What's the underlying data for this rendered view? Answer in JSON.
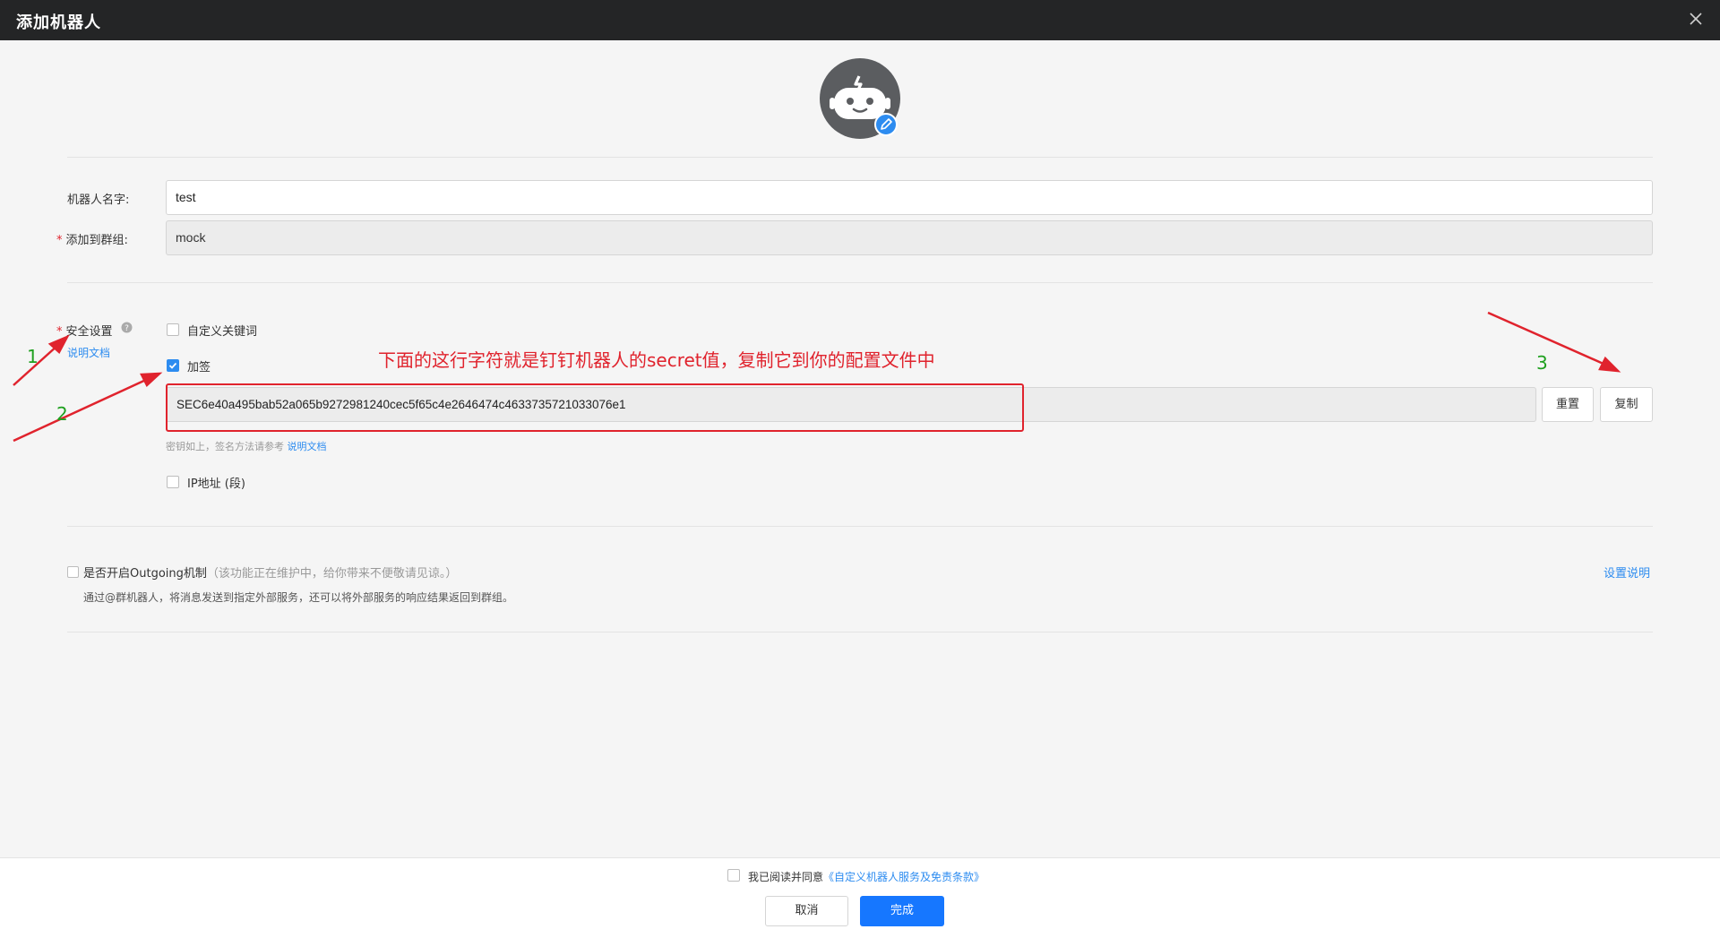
{
  "dialog": {
    "title": "添加机器人"
  },
  "colors": {
    "accent": "#2d8cf0",
    "primary_button": "#1677ff",
    "annotation": "#e0232d",
    "annotation_number": "#1fa01f",
    "titlebar": "#242526"
  },
  "icons": {
    "close": "close-icon",
    "avatar": "robot-avatar-icon",
    "edit": "pencil-icon",
    "help": "question-circle-icon"
  },
  "form": {
    "name_label": "机器人名字:",
    "name_value": "test",
    "group_required": "*",
    "group_label": "添加到群组:",
    "group_value": "mock",
    "security_required": "*",
    "security_label": "安全设置",
    "security_doc_link": "说明文档",
    "custom_keyword_label": "自定义关键词",
    "sign_label": "加签",
    "secret_value": "SEC6e40a495bab52a065b9272981240cec5f65c4e2646474c4633735721033076e1",
    "reset_button": "重置",
    "copy_button": "复制",
    "secret_hint": "密钥如上，签名方法请参考",
    "secret_hint_link": "说明文档",
    "ip_label": "IP地址 (段)"
  },
  "outgoing": {
    "label": "是否开启Outgoing机制",
    "note": "（该功能正在维护中，给你带来不便敬请见谅。）",
    "desc": "通过@群机器人，将消息发送到指定外部服务，还可以将外部服务的响应结果返回到群组。",
    "help_link": "设置说明"
  },
  "annotations": {
    "text": "下面的这行字符就是钉钉机器人的secret值，复制它到你的配置文件中",
    "n1": "1",
    "n2": "2",
    "n3": "3"
  },
  "footer": {
    "agree_text": "我已阅读并同意",
    "agree_link": "《自定义机器人服务及免责条款》",
    "cancel_button": "取消",
    "done_button": "完成"
  }
}
